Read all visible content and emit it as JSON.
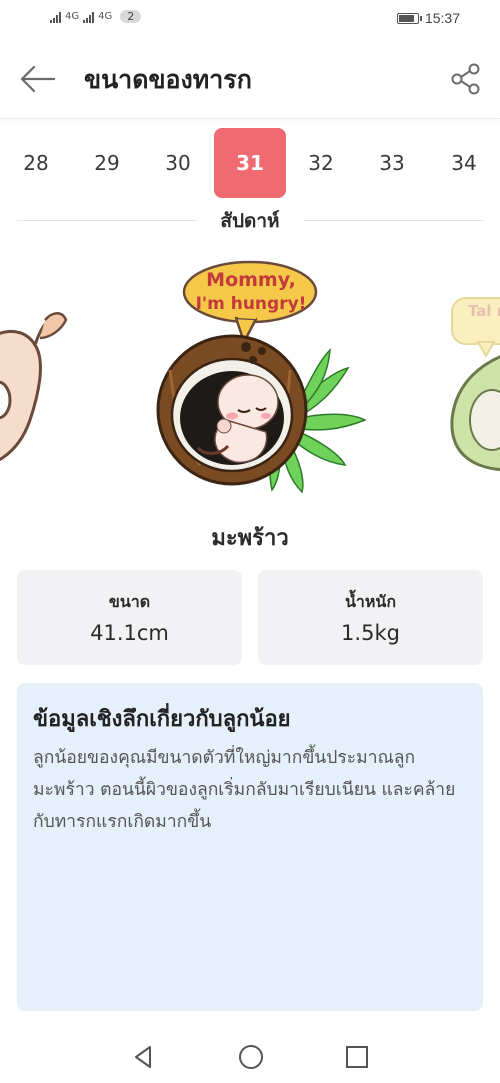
{
  "status_bar": {
    "network_1": "4G",
    "network_2": "4G",
    "sim_badge": "2",
    "battery_level": 0.9,
    "time": "15:37"
  },
  "header": {
    "title": "ขนาดของทารก",
    "back_icon": "back-arrow-icon",
    "share_icon": "share-icon"
  },
  "weeks": {
    "items": [
      "28",
      "29",
      "30",
      "31",
      "32",
      "33",
      "34"
    ],
    "selected": "31",
    "label": "สัปดาห์"
  },
  "illustration": {
    "bubble_line1": "Mommy,",
    "bubble_line2": "I'm hungry!",
    "next_bubble_partial": "Tal m"
  },
  "fruit": {
    "name": "มะพร้าว"
  },
  "stats": {
    "size_label": "ขนาด",
    "size_value": "41.1cm",
    "weight_label": "น้ำหนัก",
    "weight_value": "1.5kg"
  },
  "insight": {
    "title": "ข้อมูลเชิงลึกเกี่ยวกับลูกน้อย",
    "body": "ลูกน้อยของคุณมีขนาดตัวที่ใหญ่มากขึ้นประมาณลูกมะพร้าว ตอนนี้ผิวของลูกเริ่มกลับมาเรียบเนียน และคล้ายกับทารกแรกเกิดมากขึ้น"
  },
  "colors": {
    "accent": "#f06a72",
    "insight_bg": "#e5f0fb",
    "card_bg": "#f2f2f4"
  },
  "nav": {
    "back_icon": "nav-back-icon",
    "home_icon": "nav-home-icon",
    "recents_icon": "nav-recents-icon"
  }
}
